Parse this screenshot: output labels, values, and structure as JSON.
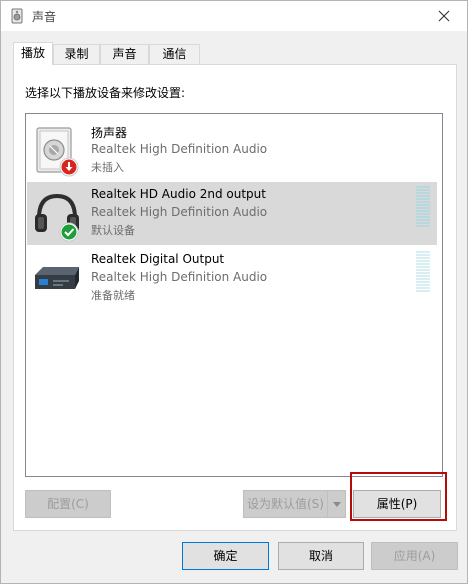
{
  "window": {
    "title": "声音"
  },
  "tabs": [
    {
      "label": "播放"
    },
    {
      "label": "录制"
    },
    {
      "label": "声音"
    },
    {
      "label": "通信"
    }
  ],
  "panel": {
    "instruction": "选择以下播放设备来修改设置:"
  },
  "devices": [
    {
      "name": "扬声器",
      "description": "Realtek High Definition Audio",
      "status": "未插入"
    },
    {
      "name": "Realtek HD Audio 2nd output",
      "description": "Realtek High Definition Audio",
      "status": "默认设备"
    },
    {
      "name": "Realtek Digital Output",
      "description": "Realtek High Definition Audio",
      "status": "准备就绪"
    }
  ],
  "panel_buttons": {
    "configure": "配置(C)",
    "set_default": "设为默认值(S)",
    "properties": "属性(P)"
  },
  "footer": {
    "ok": "确定",
    "cancel": "取消",
    "apply": "应用(A)"
  },
  "colors": {
    "selected_row": "#d9d9d9",
    "highlight_box": "#b40c0c",
    "focus_border": "#0078d7",
    "status_ok": "#1e9e3a",
    "status_unplugged": "#d7261e"
  }
}
